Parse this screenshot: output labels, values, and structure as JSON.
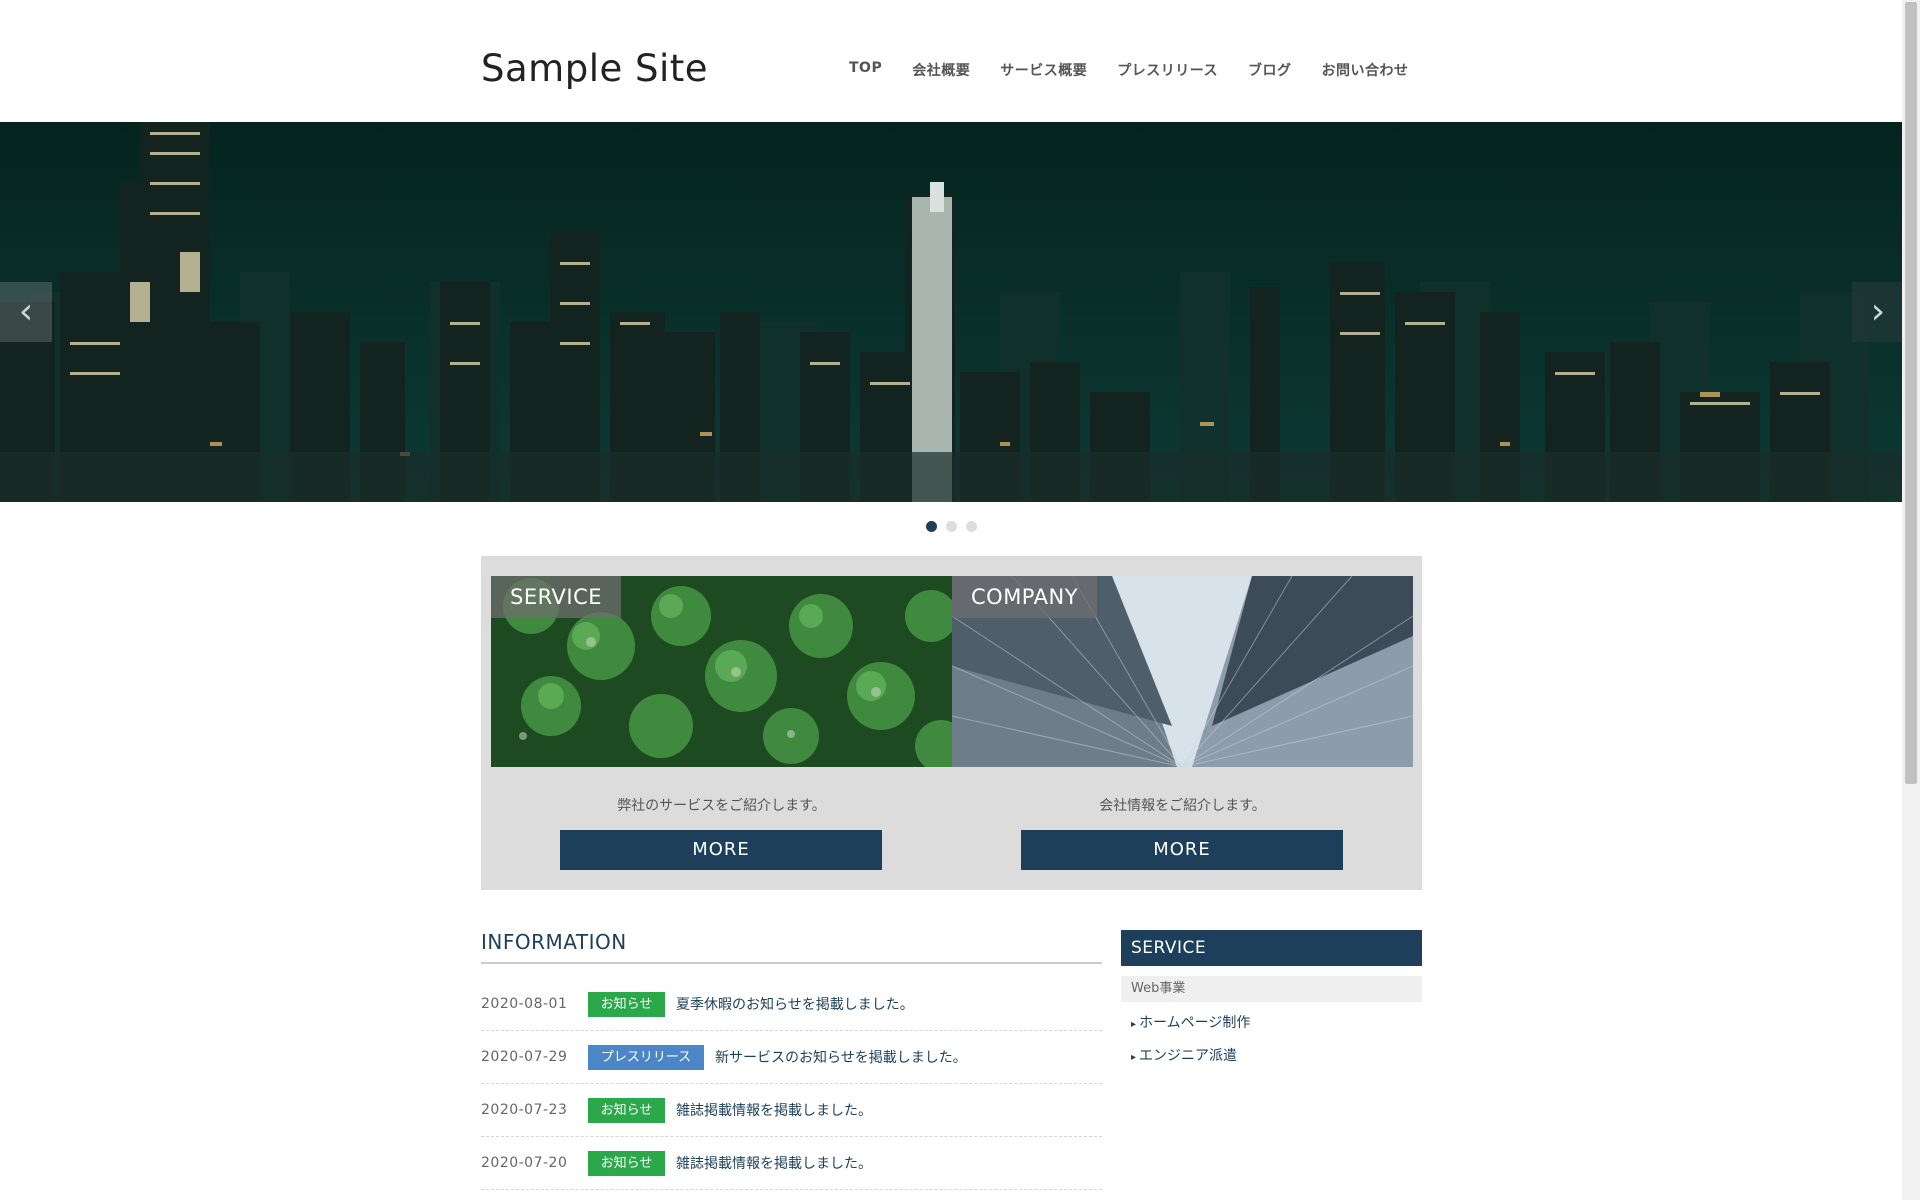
{
  "site": {
    "logo": "Sample Site"
  },
  "nav": {
    "items": [
      {
        "label": "TOP"
      },
      {
        "label": "会社概要"
      },
      {
        "label": "サービス概要"
      },
      {
        "label": "プレスリリース"
      },
      {
        "label": "ブログ"
      },
      {
        "label": "お問い合わせ"
      }
    ]
  },
  "slider": {
    "prev_icon": "chevron-left-icon",
    "next_icon": "chevron-right-icon",
    "prev_glyph": "‹",
    "next_glyph": "›",
    "slide_count": 3,
    "active_index": 0
  },
  "features": {
    "service": {
      "label": "SERVICE",
      "description": "弊社のサービスをご紹介します。",
      "button": "MORE"
    },
    "company": {
      "label": "COMPANY",
      "description": "会社情報をご紹介します。",
      "button": "MORE"
    }
  },
  "information": {
    "title": "INFORMATION",
    "items": [
      {
        "date": "2020-08-01",
        "category": "お知らせ",
        "category_color": "#2ba84a",
        "text": "夏季休暇のお知らせを掲載しました。"
      },
      {
        "date": "2020-07-29",
        "category": "プレスリリース",
        "category_color": "#4c86c6",
        "text": "新サービスのお知らせを掲載しました。"
      },
      {
        "date": "2020-07-23",
        "category": "お知らせ",
        "category_color": "#2ba84a",
        "text": "雑誌掲載情報を掲載しました。"
      },
      {
        "date": "2020-07-20",
        "category": "お知らせ",
        "category_color": "#2ba84a",
        "text": "雑誌掲載情報を掲載しました。"
      }
    ]
  },
  "sidebar": {
    "title": "SERVICE",
    "subheading": "Web事業",
    "links": [
      {
        "label": "ホームページ制作"
      },
      {
        "label": "エンジニア派遣"
      }
    ]
  },
  "colors": {
    "accent": "#1d3f5b",
    "green_badge": "#2ba84a",
    "blue_badge": "#4c86c6"
  }
}
